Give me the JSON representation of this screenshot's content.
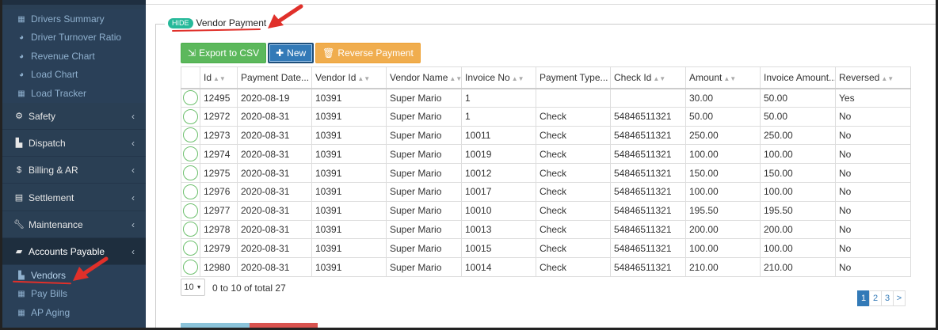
{
  "sidebar": {
    "sub_items_top": [
      {
        "label": "Drivers Summary",
        "icon": "grid-icon"
      },
      {
        "label": "Driver Turnover Ratio",
        "icon": "pie-chart-icon"
      },
      {
        "label": "Revenue Chart",
        "icon": "pie-chart-icon"
      },
      {
        "label": "Load Chart",
        "icon": "pie-chart-icon"
      },
      {
        "label": "Load Tracker",
        "icon": "grid-icon"
      }
    ],
    "main_items": [
      {
        "label": "Safety",
        "icon": "cogs-icon"
      },
      {
        "label": "Dispatch",
        "icon": "truck-icon"
      },
      {
        "label": "Billing & AR",
        "icon": "dollar-icon"
      },
      {
        "label": "Settlement",
        "icon": "calculator-icon"
      },
      {
        "label": "Maintenance",
        "icon": "wrench-icon"
      },
      {
        "label": "Accounts Payable",
        "icon": "book-icon"
      }
    ],
    "sub_items_ap": [
      {
        "label": "Vendors",
        "icon": "truck-icon"
      },
      {
        "label": "Pay Bills",
        "icon": "grid-icon"
      },
      {
        "label": "AP Aging",
        "icon": "grid-icon"
      }
    ]
  },
  "section": {
    "hide_label": "HIDE",
    "title": "Vendor Payment"
  },
  "toolbar": {
    "export_label": "Export to CSV",
    "new_label": "New",
    "reverse_label": "Reverse Payment"
  },
  "table": {
    "columns": [
      "Id",
      "Payment Date...",
      "Vendor Id",
      "Vendor Name",
      "Invoice No",
      "Payment Type...",
      "Check Id",
      "Amount",
      "Invoice Amount...",
      "Reversed"
    ],
    "rows": [
      [
        "12495",
        "2020-08-19",
        "10391",
        "Super Mario",
        "1",
        "",
        "",
        "30.00",
        "50.00",
        "Yes"
      ],
      [
        "12972",
        "2020-08-31",
        "10391",
        "Super Mario",
        "1",
        "Check",
        "54846511321",
        "50.00",
        "50.00",
        "No"
      ],
      [
        "12973",
        "2020-08-31",
        "10391",
        "Super Mario",
        "10011",
        "Check",
        "54846511321",
        "250.00",
        "250.00",
        "No"
      ],
      [
        "12974",
        "2020-08-31",
        "10391",
        "Super Mario",
        "10019",
        "Check",
        "54846511321",
        "100.00",
        "100.00",
        "No"
      ],
      [
        "12975",
        "2020-08-31",
        "10391",
        "Super Mario",
        "10012",
        "Check",
        "54846511321",
        "150.00",
        "150.00",
        "No"
      ],
      [
        "12976",
        "2020-08-31",
        "10391",
        "Super Mario",
        "10017",
        "Check",
        "54846511321",
        "100.00",
        "100.00",
        "No"
      ],
      [
        "12977",
        "2020-08-31",
        "10391",
        "Super Mario",
        "10010",
        "Check",
        "54846511321",
        "195.50",
        "195.50",
        "No"
      ],
      [
        "12978",
        "2020-08-31",
        "10391",
        "Super Mario",
        "10013",
        "Check",
        "54846511321",
        "200.00",
        "200.00",
        "No"
      ],
      [
        "12979",
        "2020-08-31",
        "10391",
        "Super Mario",
        "10015",
        "Check",
        "54846511321",
        "100.00",
        "100.00",
        "No"
      ],
      [
        "12980",
        "2020-08-31",
        "10391",
        "Super Mario",
        "10014",
        "Check",
        "54846511321",
        "210.00",
        "210.00",
        "No"
      ]
    ]
  },
  "pager": {
    "page_size": "10",
    "info": "0 to 10 of total 27",
    "pages": [
      "1",
      "2",
      "3"
    ],
    "next": ">"
  },
  "colors": {
    "sidebar_bg": "#2a3f54",
    "accent_green": "#5cb85c",
    "accent_blue": "#337ab7",
    "accent_orange": "#f0ad4e",
    "annotation_red": "#e0302a"
  }
}
